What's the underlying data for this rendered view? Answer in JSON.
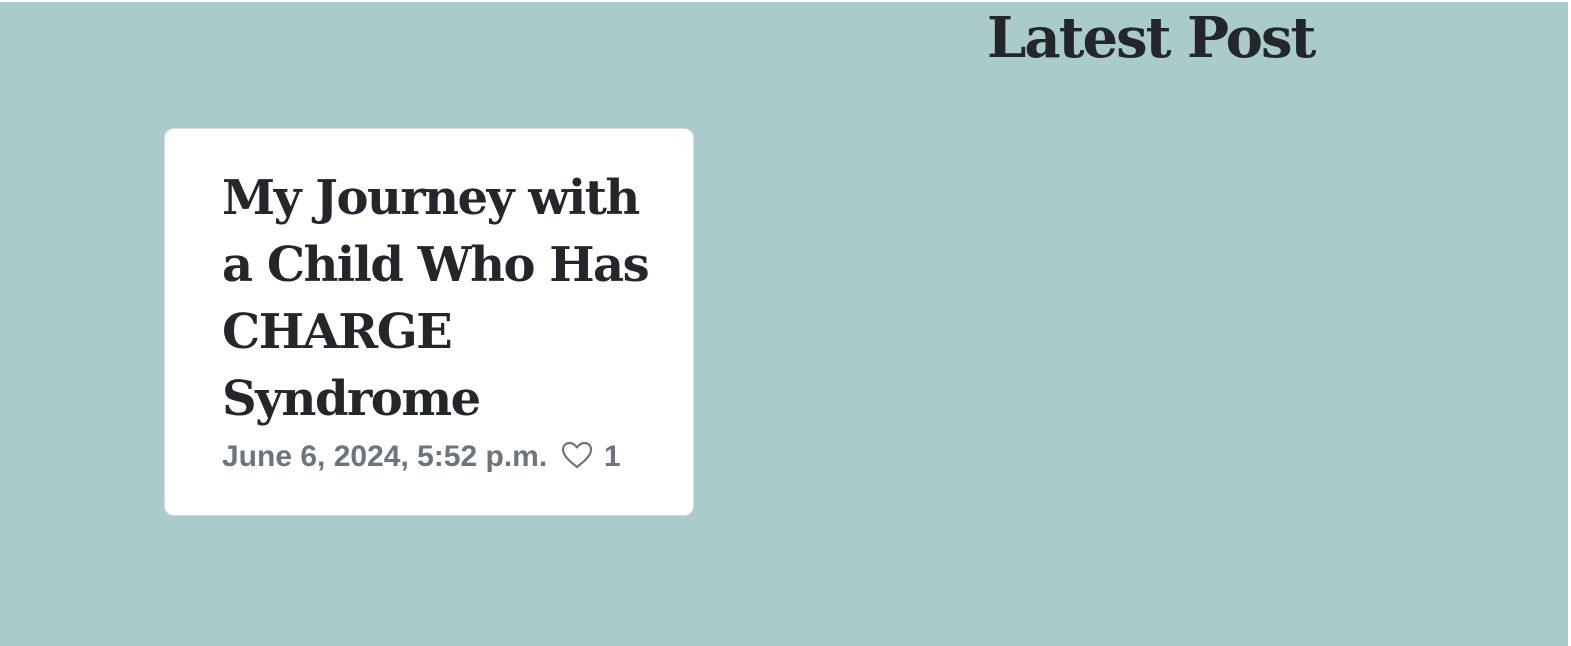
{
  "heading": "Latest Post",
  "posts": [
    {
      "title": "My Journey with a Child Who Has CHARGE Syndrome",
      "date": "June 6, 2024, 5:52 p.m.",
      "likes": "1"
    }
  ],
  "icons": {
    "like": "heart-outline-icon"
  },
  "colors": {
    "background": "#aacbcb",
    "card": "#ffffff",
    "heading_text": "#23272b",
    "meta_text": "#6c757d"
  }
}
